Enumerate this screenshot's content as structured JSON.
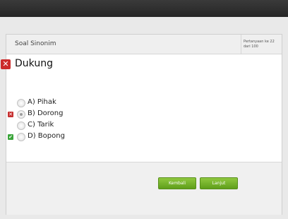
{
  "quiz": {
    "title": "Soal Sinonim",
    "progress": "Pertanyaan ke 22 dari 100"
  },
  "question": {
    "text": "Dukung",
    "status_mark": "✕"
  },
  "options": [
    {
      "label": "A) Pihak",
      "selected": false,
      "mark": ""
    },
    {
      "label": "B) Dorong",
      "selected": true,
      "mark": "✕"
    },
    {
      "label": "C) Tarik",
      "selected": false,
      "mark": ""
    },
    {
      "label": "D) Bopong",
      "selected": false,
      "mark": "✔"
    }
  ],
  "buttons": {
    "back": "Kembali",
    "next": "Lanjut"
  },
  "colors": {
    "topbar": "#2f2f2f",
    "wrong": "#c63030",
    "correct": "#3aa53a",
    "button": "#6aab24"
  }
}
